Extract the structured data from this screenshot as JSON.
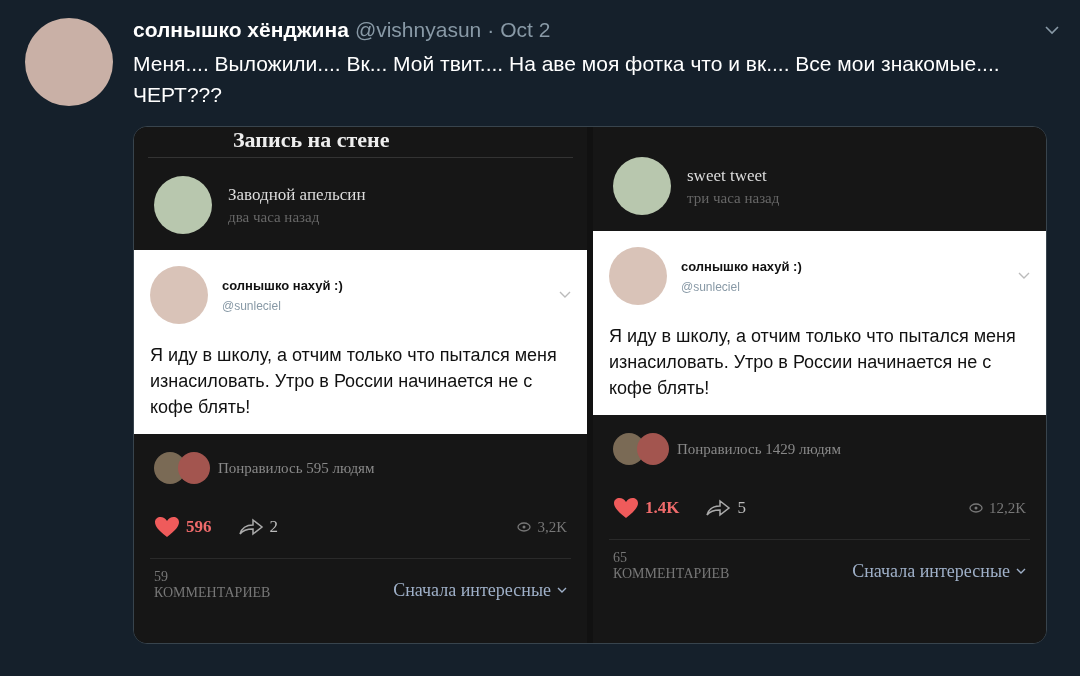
{
  "tweet": {
    "author": "солнышко хёнджина",
    "handle": "@vishnyasun",
    "separator": "·",
    "date": "Oct 2",
    "text": "Меня.... Выложили.... Вк... Мой твит.... На аве моя фотка что и вк.... Все мои знакомые.... ЧЕРТ???"
  },
  "screenshots": [
    {
      "header": "Запись на стене",
      "poster": "Заводной апельсин",
      "time": "два часа назад",
      "quoted": {
        "name": "солнышко нахуй :)",
        "handle": "@sunleciel",
        "text": "Я иду в школу, а отчим только что пытался меня изнасиловать. Утро в России начинается не с кофе блять!"
      },
      "liked_by": "Понравилось 595 людям",
      "likes": "596",
      "shares": "2",
      "views": "3,2K",
      "comments_count": "59",
      "comments_label": "КОММЕНТАРИЕВ",
      "sort": "Сначала интересные"
    },
    {
      "poster": "sweet tweet",
      "time": "три часа назад",
      "quoted": {
        "name": "солнышко нахуй :)",
        "handle": "@sunleciel",
        "text": "Я иду в школу, а отчим только что пытался меня изнасиловать. Утро в России начинается не с кофе блять!"
      },
      "liked_by": "Понравилось 1429 людям",
      "likes": "1.4K",
      "shares": "5",
      "views": "12,2K",
      "comments_count": "65",
      "comments_label": "КОММЕНТАРИЕВ",
      "sort": "Сначала интересные"
    }
  ]
}
